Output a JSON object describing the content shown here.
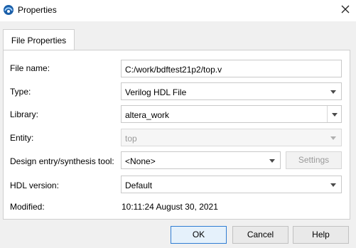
{
  "window": {
    "title": "Properties"
  },
  "tabs": {
    "file_properties": "File Properties"
  },
  "form": {
    "file_name": {
      "label": "File name:",
      "value": "C:/work/bdftest21p2/top.v"
    },
    "type": {
      "label": "Type:",
      "value": "Verilog HDL File"
    },
    "library": {
      "label": "Library:",
      "value": "altera_work"
    },
    "entity": {
      "label": "Entity:",
      "value": "top"
    },
    "design_tool": {
      "label": "Design entry/synthesis tool:",
      "value": "<None>",
      "settings_label": "Settings"
    },
    "hdl_version": {
      "label": "HDL version:",
      "value": "Default"
    },
    "modified": {
      "label": "Modified:",
      "value": "10:11:24 August 30, 2021"
    }
  },
  "buttons": {
    "ok": "OK",
    "cancel": "Cancel",
    "help": "Help"
  }
}
